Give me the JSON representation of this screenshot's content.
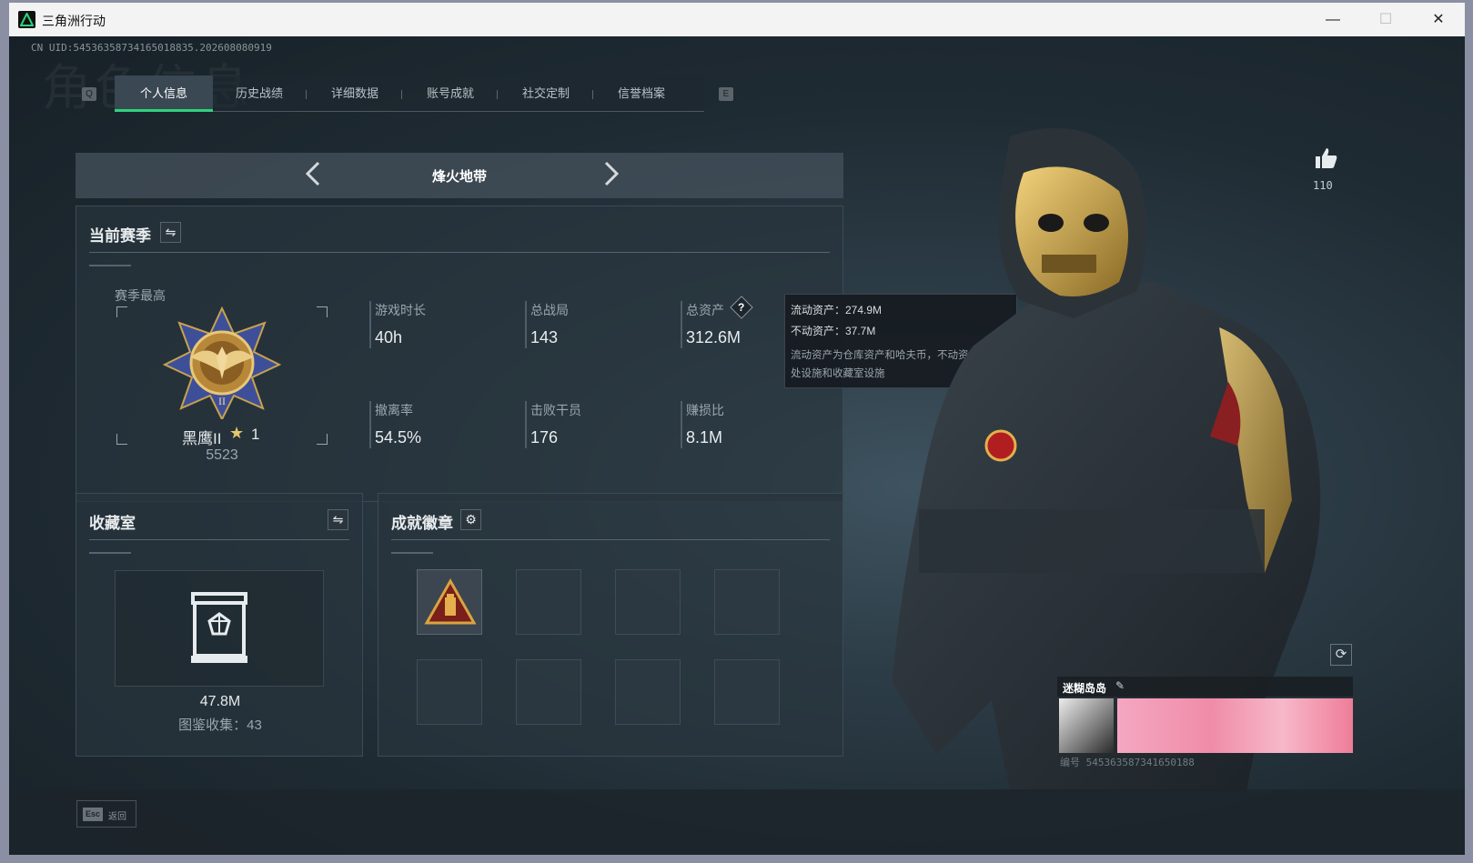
{
  "window": {
    "title": "三角洲行动",
    "minimize": "—",
    "maximize": "☐",
    "close": "✕"
  },
  "uid": "CN UID:545363587341650188​35.202608080919",
  "background_text": "角色信息",
  "tabs": {
    "q_key": "Q",
    "e_key": "E",
    "items": [
      {
        "label": "个人信息",
        "active": true
      },
      {
        "label": "历史战绩"
      },
      {
        "label": "详细数据"
      },
      {
        "label": "账号成就"
      },
      {
        "label": "社交定制"
      },
      {
        "label": "信誉档案"
      }
    ]
  },
  "map": {
    "prev": "‹",
    "name": "烽火地带",
    "next": "›"
  },
  "season": {
    "title": "当前赛季",
    "switch_icon": "swap-icon",
    "best_label": "赛季最高",
    "rank_name": "黑鹰II",
    "rank_stars": "1",
    "rank_score": "5523",
    "stats": [
      {
        "label": "游戏时长",
        "value": "40h"
      },
      {
        "label": "总战局",
        "value": "143"
      },
      {
        "label": "总资产",
        "value": "312.6M"
      },
      {
        "label": "撤离率",
        "value": "54.5%"
      },
      {
        "label": "击败干员",
        "value": "176"
      },
      {
        "label": "赚损比",
        "value": "8.1M"
      }
    ],
    "help_glyph": "?"
  },
  "tooltip": {
    "liquid": "流动资产：274.9M",
    "fixed": "不动资产：37.7M",
    "desc": "流动资产为仓库资产和哈夫币，不动资产为特勤处设施和收藏室设施"
  },
  "collection": {
    "title": "收藏室",
    "value": "47.8M",
    "count": "图鉴收集：43"
  },
  "achievements": {
    "title": "成就徽章",
    "settings_icon": "gear-icon"
  },
  "likes": {
    "count": "110"
  },
  "namecard": {
    "name": "迷糊岛岛",
    "edit_glyph": "✎",
    "id": "编号 545363587341650188"
  },
  "footer": {
    "esc_key": "Esc",
    "esc_label": "返回"
  },
  "colors": {
    "accent": "#2fd27b",
    "gold": "#e7c56a"
  }
}
